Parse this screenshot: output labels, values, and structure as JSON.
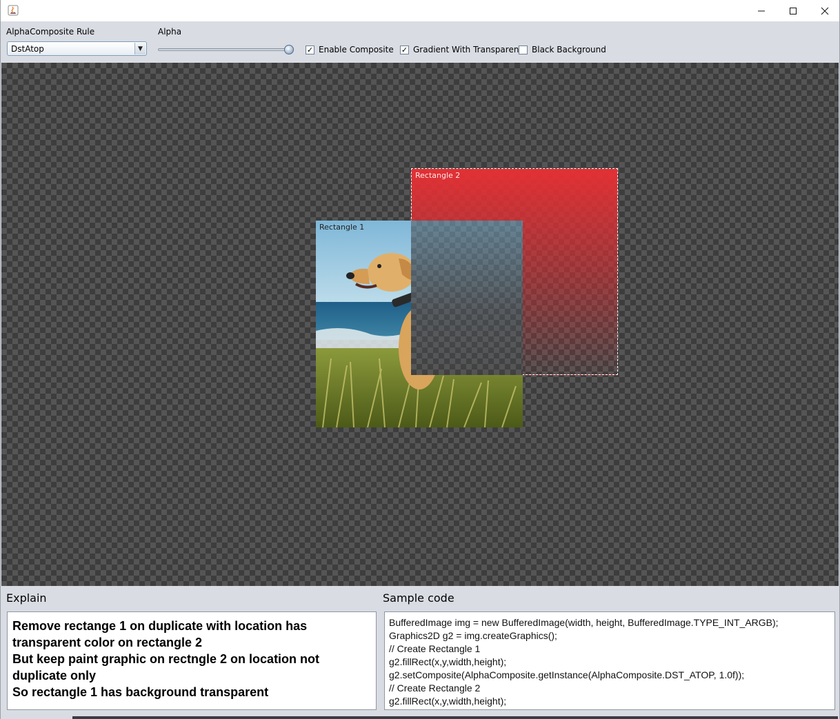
{
  "toolbar": {
    "rule_label": "AlphaComposite Rule",
    "rule_value": "DstAtop",
    "alpha_label": "Alpha",
    "alpha_value": 1.0,
    "enable_composite": {
      "label": "Enable Composite",
      "checked": true
    },
    "gradient_transparent": {
      "label": "Gradient With Transparent",
      "checked": true
    },
    "black_background": {
      "label": "Black Background",
      "checked": false
    }
  },
  "canvas": {
    "rect1_label": "Rectangle 1",
    "rect2_label": "Rectangle 2",
    "rect2_color": "#e33036"
  },
  "explain": {
    "title": "Explain",
    "lines": [
      "Remove rectange 1 on duplicate with location has",
      "transparent color on rectangle 2",
      "But keep paint graphic on rectngle 2 on location not",
      "duplicate only",
      "So rectangle 1 has background transparent"
    ]
  },
  "code": {
    "title": "Sample code",
    "lines": [
      "BufferedImage img = new BufferedImage(width, height, BufferedImage.TYPE_INT_ARGB);",
      "Graphics2D g2 = img.createGraphics();",
      "// Create Rectangle 1",
      "g2.fillRect(x,y,width,height);",
      "g2.setComposite(AlphaComposite.getInstance(AlphaComposite.DST_ATOP, 1.0f));",
      "// Create Rectangle 2",
      "g2.fillRect(x,y,width,height);"
    ]
  }
}
